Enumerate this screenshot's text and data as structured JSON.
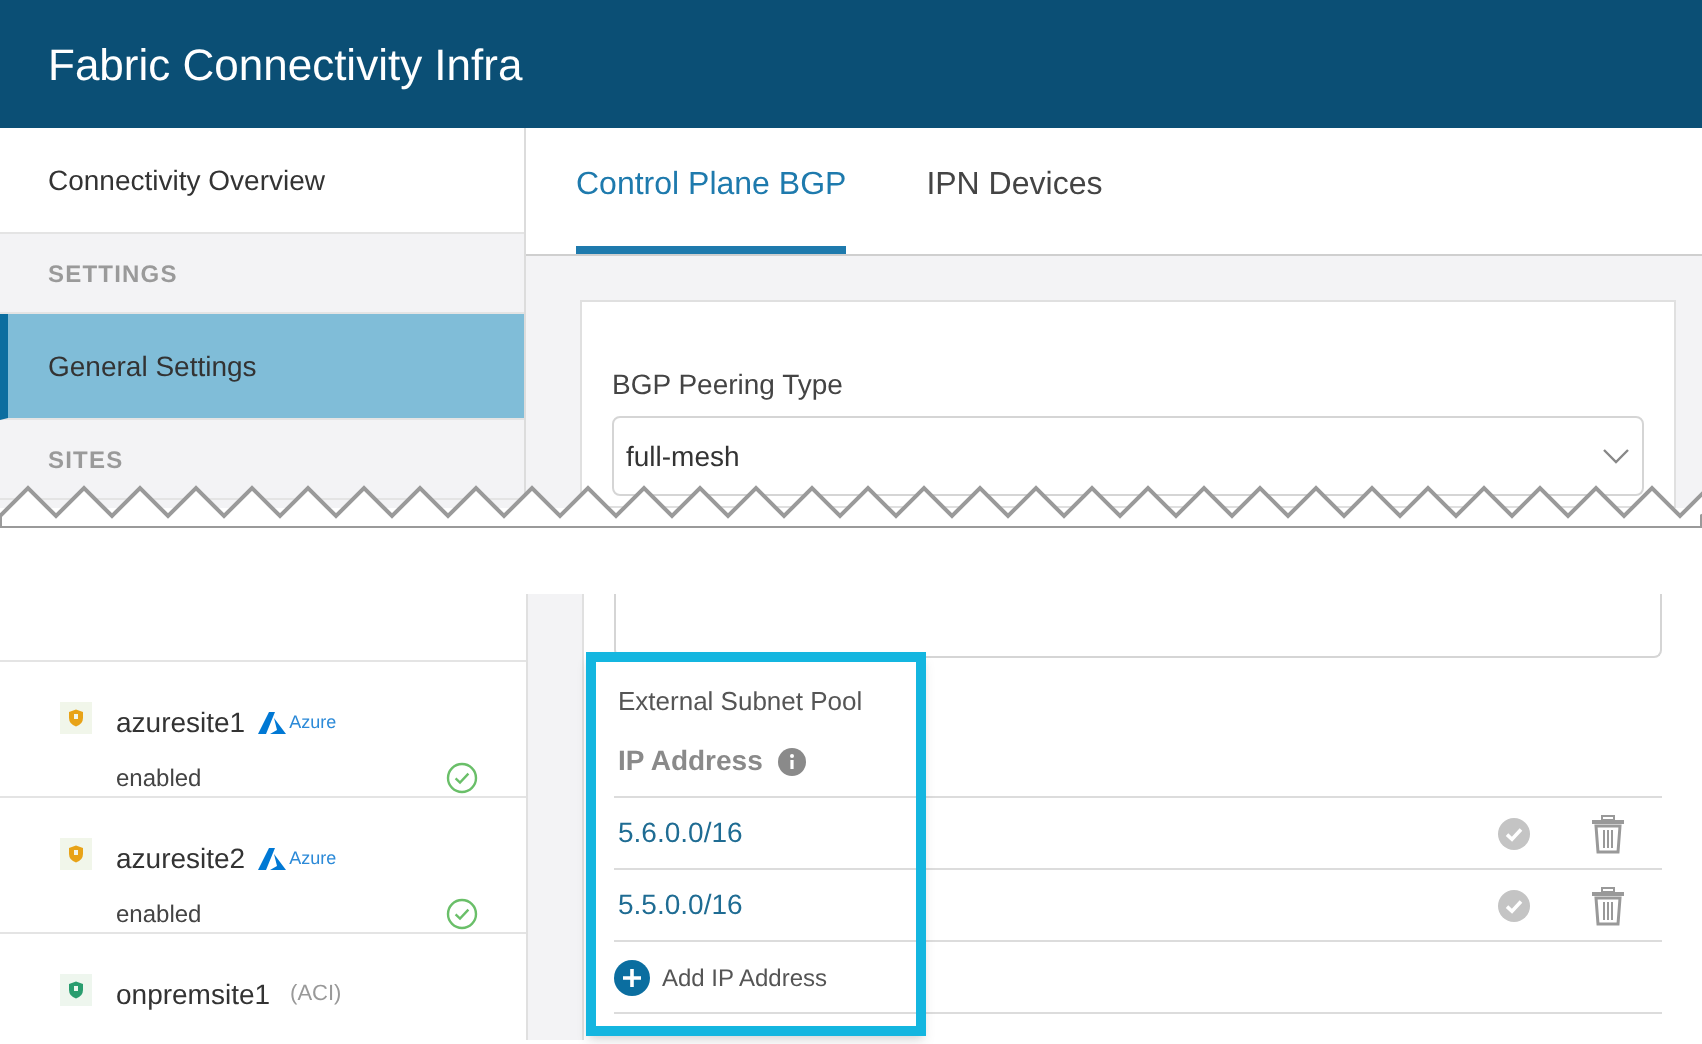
{
  "window": {
    "title": "Fabric Connectivity Infra"
  },
  "sidebar": [
    {
      "kind": "item",
      "label": "Connectivity Overview",
      "selected": false
    },
    {
      "kind": "heading",
      "label": "SETTINGS"
    },
    {
      "kind": "item",
      "label": "General Settings",
      "selected": true
    },
    {
      "kind": "heading",
      "label": "SITES"
    }
  ],
  "tabs": [
    {
      "label": "Control Plane BGP",
      "selected": true
    },
    {
      "label": "IPN Devices",
      "selected": false
    }
  ],
  "bgp_peering": {
    "label": "BGP Peering Type",
    "value": "full-mesh"
  },
  "sites": [
    {
      "name": "azuresite1",
      "kind": "azure",
      "badge": "Azure",
      "status": "enabled",
      "healthy": true
    },
    {
      "name": "azuresite2",
      "kind": "azure",
      "badge": "Azure",
      "status": "enabled",
      "healthy": true
    },
    {
      "name": "onpremsite1",
      "kind": "aci",
      "badge": "(ACI)"
    }
  ],
  "subnet_pool": {
    "label": "External Subnet Pool",
    "column": "IP Address",
    "rows": [
      {
        "value": "5.6.0.0/16"
      },
      {
        "value": "5.5.0.0/16"
      }
    ],
    "add_label": "Add IP Address"
  }
}
